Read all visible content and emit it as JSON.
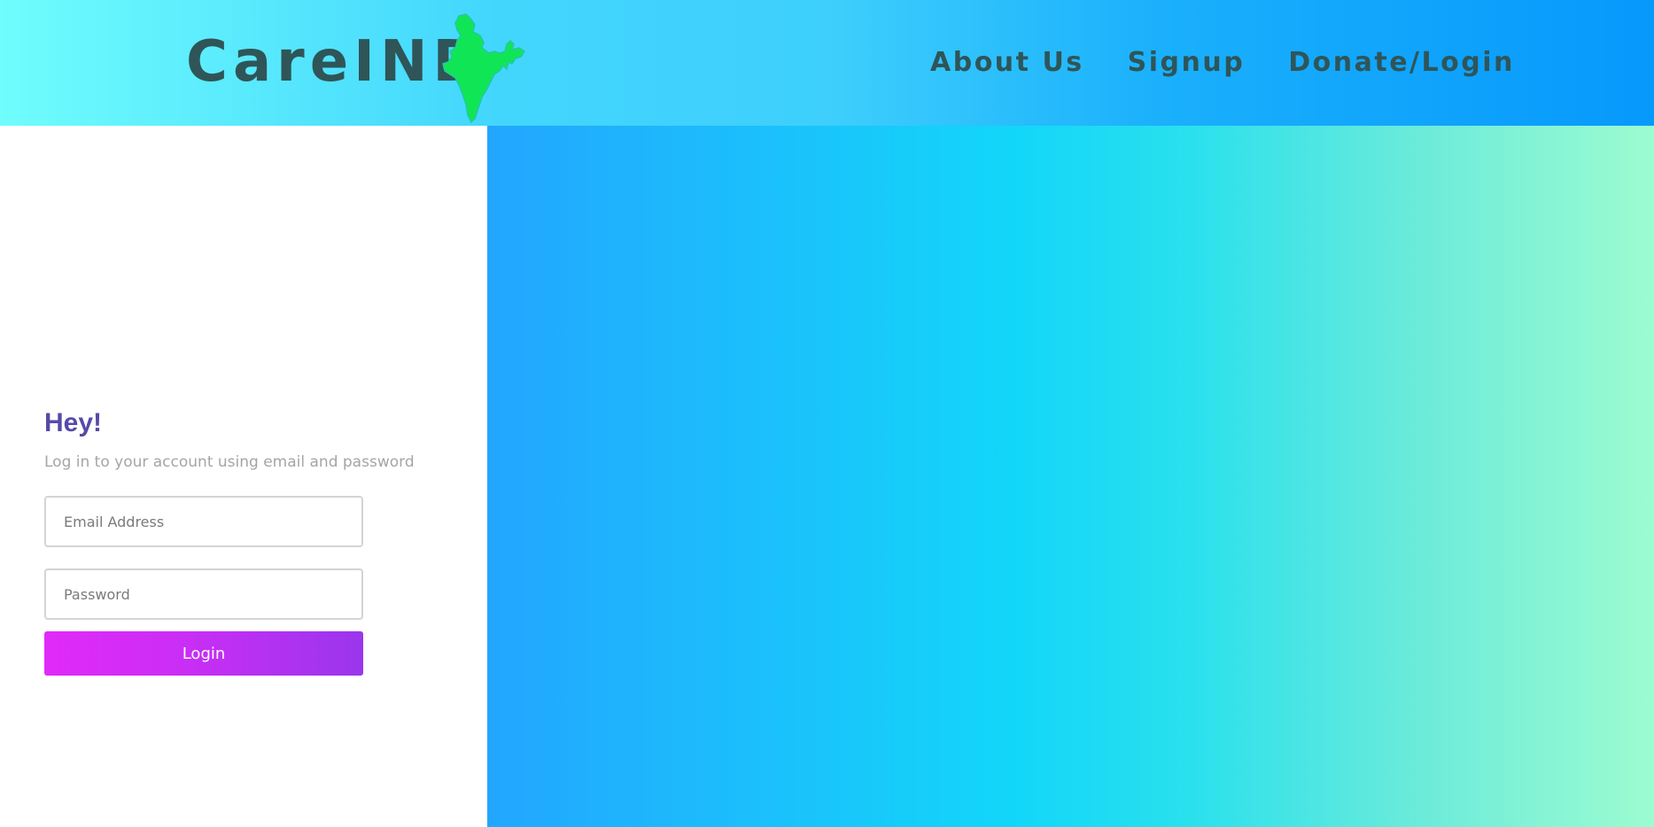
{
  "header": {
    "brand": "CareIND",
    "logo_icon": "india-map-icon",
    "nav": [
      {
        "label": "About Us"
      },
      {
        "label": "Signup"
      },
      {
        "label": "Donate/Login"
      }
    ]
  },
  "login": {
    "title": "Hey!",
    "subtitle": "Log in to your account using email and password",
    "email_placeholder": "Email Address",
    "password_placeholder": "Password",
    "button_label": "Login"
  },
  "colors": {
    "nav_text": "#2f5558",
    "title": "#554aa8",
    "button_start": "#e12af8",
    "button_end": "#9a36ec",
    "map_green": "#10e655"
  }
}
